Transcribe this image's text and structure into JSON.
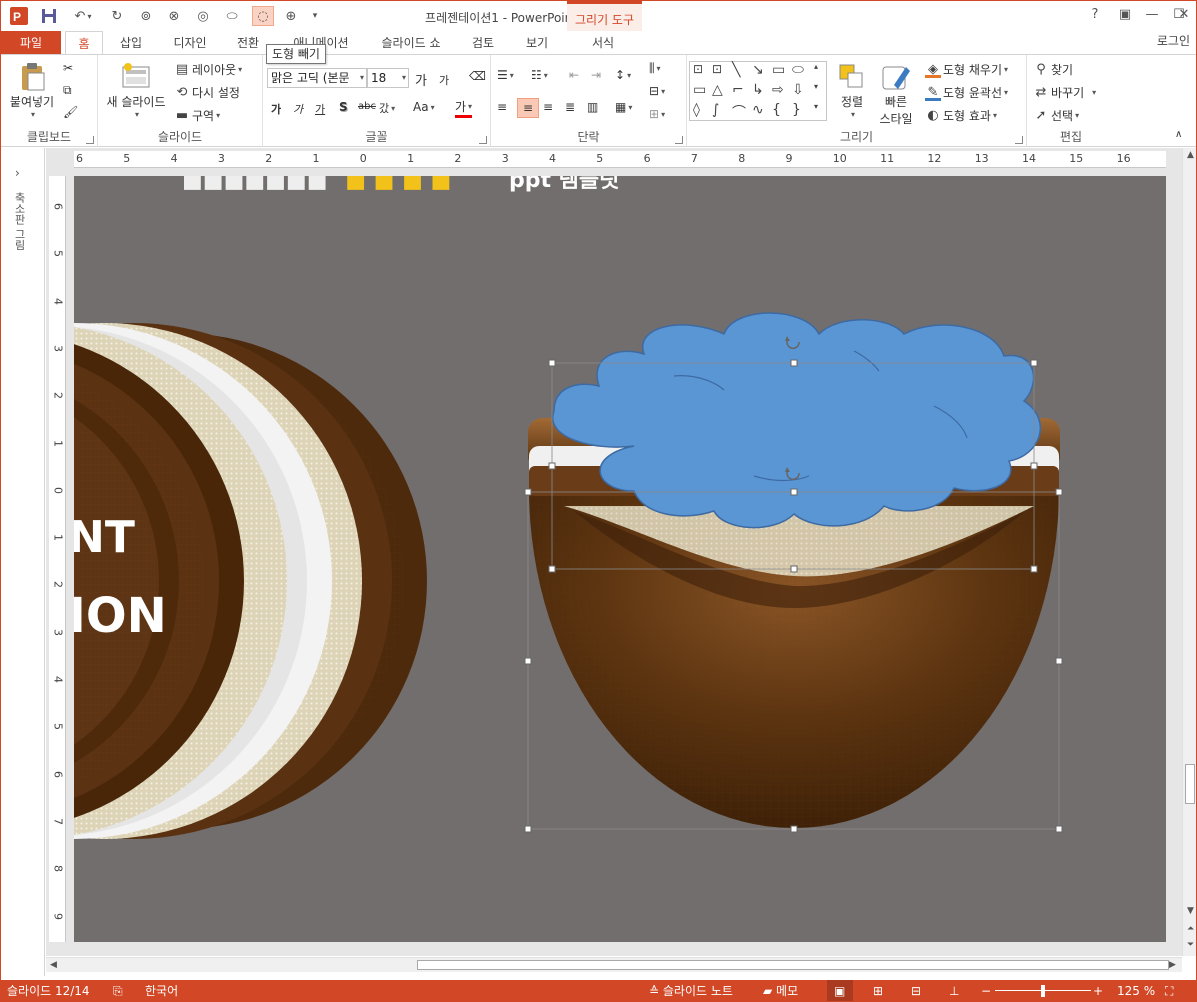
{
  "app": {
    "window_title": "프레젠테이션1 - PowerPoint",
    "tool_context": "그리기 도구",
    "login": "로그인"
  },
  "qat_icons": [
    "powerpoint-logo-icon",
    "save-icon",
    "undo-icon",
    "redo-icon",
    "shape-tool-icon",
    "shape-tool-icon",
    "shape-tool-icon",
    "shape-tool-icon",
    "shape-subtract-icon",
    "shape-tool-icon",
    "qat-more-icon"
  ],
  "tabs": [
    {
      "id": "file",
      "label": "파일"
    },
    {
      "id": "home",
      "label": "홈"
    },
    {
      "id": "insert",
      "label": "삽입"
    },
    {
      "id": "design",
      "label": "디자인"
    },
    {
      "id": "transitions",
      "label": "전환"
    },
    {
      "id": "animations",
      "label": "애니메이션"
    },
    {
      "id": "slideshow",
      "label": "슬라이드 쇼"
    },
    {
      "id": "review",
      "label": "검토"
    },
    {
      "id": "view",
      "label": "보기"
    },
    {
      "id": "format",
      "label": "서식"
    }
  ],
  "tooltip": "도형 빼기",
  "ribbon": {
    "clipboard": {
      "label": "클립보드",
      "paste": "붙여넣기"
    },
    "slides": {
      "label": "슬라이드",
      "new_slide": "새 슬라이드",
      "layout": "레이아웃",
      "reset": "다시 설정",
      "section": "구역"
    },
    "font": {
      "label": "글꼴",
      "font_name": "맑은 고딕 (본문",
      "font_size": "18",
      "grow": "가",
      "shrink": "가",
      "bold": "가",
      "italic": "가",
      "underline": "가",
      "shadow": "S",
      "strike": "abc",
      "spacing": "갔",
      "change_case": "Aa",
      "font_color": "가"
    },
    "paragraph": {
      "label": "단락"
    },
    "drawing": {
      "label": "그리기",
      "arrange": "정렬",
      "quick_styles_1": "빠른",
      "quick_styles_2": "스타일",
      "shape_fill": "도형 채우기",
      "shape_outline": "도형 윤곽선",
      "shape_effects": "도형 효과",
      "outline_color": "#3c7bc2",
      "fill_color": "#e8742a"
    },
    "editing": {
      "label": "편집",
      "find": "찾기",
      "replace": "바꾸기",
      "select": "선택"
    }
  },
  "thumb_pane": {
    "label": "축소판 그림"
  },
  "ruler": {
    "h_ticks": [
      "6",
      "5",
      "4",
      "3",
      "2",
      "1",
      "0",
      "1",
      "2",
      "3",
      "4",
      "5",
      "6",
      "7",
      "8",
      "9",
      "10",
      "11",
      "12",
      "13",
      "14",
      "15",
      "16"
    ],
    "v_ticks": [
      "6",
      "5",
      "4",
      "3",
      "2",
      "1",
      "0",
      "1",
      "2",
      "3",
      "4",
      "5",
      "6",
      "7",
      "8",
      "9"
    ]
  },
  "slide": {
    "title_partial": "ppt 템플릿",
    "big_text_1": "NT",
    "big_text_2": "ION",
    "cloud_fill": "#5a96d4",
    "background": "#726e6d"
  },
  "status": {
    "slide_counter": "슬라이드 12/14",
    "language": "한국어",
    "notes": "슬라이드 노트",
    "comments": "메모",
    "zoom": "125 %"
  }
}
